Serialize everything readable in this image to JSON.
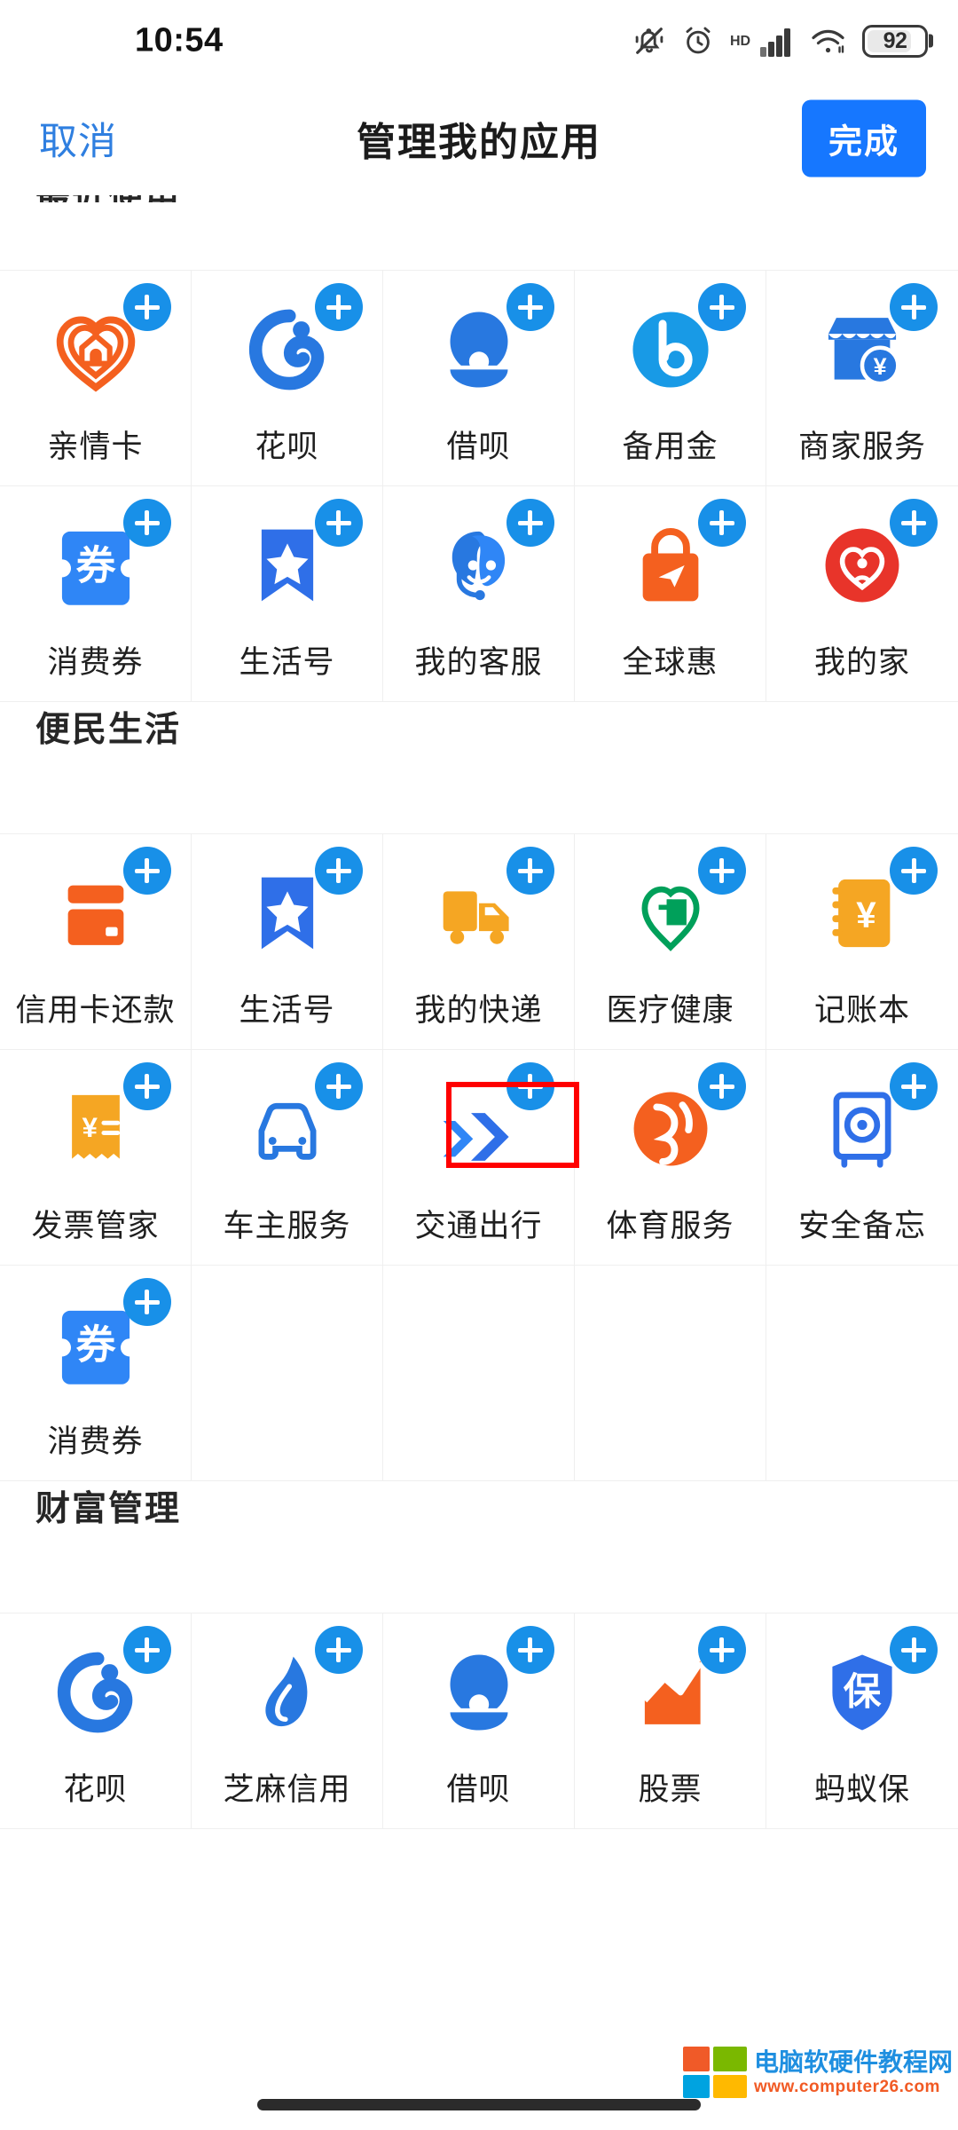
{
  "status_bar": {
    "time": "10:54",
    "battery_level": "92",
    "icons": [
      "bell-mute-icon",
      "alarm-clock-icon",
      "hd-icon",
      "signal-bars-icon",
      "wifi-icon",
      "battery-icon"
    ]
  },
  "nav": {
    "cancel_label": "取消",
    "title": "管理我的应用",
    "done_label": "完成"
  },
  "colors": {
    "accent_blue": "#1677ff",
    "plus_blue": "#1890e8",
    "link_blue": "#2f7fe0",
    "highlight_red": "#ff0000",
    "orange": "#f4601f",
    "green": "#00a05a",
    "yellow": "#f5a623",
    "red": "#e8342a"
  },
  "sections": [
    {
      "title": "最近使用",
      "clipped": true,
      "apps": [
        {
          "label": "亲情卡",
          "icon": "family-card-icon",
          "action": "add"
        },
        {
          "label": "花呗",
          "icon": "huabei-icon",
          "action": "add"
        },
        {
          "label": "借呗",
          "icon": "jiebei-icon",
          "action": "add"
        },
        {
          "label": "备用金",
          "icon": "reserve-fund-icon",
          "action": "add"
        },
        {
          "label": "商家服务",
          "icon": "merchant-service-icon",
          "action": "add"
        },
        {
          "label": "消费券",
          "icon": "coupon-icon",
          "action": "add"
        },
        {
          "label": "生活号",
          "icon": "life-account-icon",
          "action": "add"
        },
        {
          "label": "我的客服",
          "icon": "customer-service-icon",
          "action": "add"
        },
        {
          "label": "全球惠",
          "icon": "global-deals-icon",
          "action": "add"
        },
        {
          "label": "我的家",
          "icon": "my-home-icon",
          "action": "add"
        }
      ]
    },
    {
      "title": "便民生活",
      "clipped": false,
      "apps": [
        {
          "label": "信用卡还款",
          "icon": "credit-card-repay-icon",
          "action": "add"
        },
        {
          "label": "生活号",
          "icon": "life-account-icon",
          "action": "add"
        },
        {
          "label": "我的快递",
          "icon": "delivery-truck-icon",
          "action": "add"
        },
        {
          "label": "医疗健康",
          "icon": "medical-health-icon",
          "action": "add"
        },
        {
          "label": "记账本",
          "icon": "ledger-book-icon",
          "action": "add"
        },
        {
          "label": "发票管家",
          "icon": "invoice-manager-icon",
          "action": "add"
        },
        {
          "label": "车主服务",
          "icon": "car-owner-service-icon",
          "action": "add"
        },
        {
          "label": "交通出行",
          "icon": "transport-travel-icon",
          "action": "add",
          "highlighted": true
        },
        {
          "label": "体育服务",
          "icon": "sports-service-icon",
          "action": "add"
        },
        {
          "label": "安全备忘",
          "icon": "security-memo-icon",
          "action": "add"
        },
        {
          "label": "消费券",
          "icon": "coupon-icon",
          "action": "add"
        }
      ]
    },
    {
      "title": "财富管理",
      "clipped": false,
      "apps": [
        {
          "label": "花呗",
          "icon": "huabei-icon",
          "action": "add"
        },
        {
          "label": "芝麻信用",
          "icon": "zhima-credit-icon",
          "action": "add"
        },
        {
          "label": "借呗",
          "icon": "jiebei-icon",
          "action": "add"
        },
        {
          "label": "股票",
          "icon": "stock-chart-icon",
          "action": "add"
        },
        {
          "label": "蚂蚁保",
          "icon": "ant-insurance-icon",
          "action": "add"
        }
      ]
    }
  ],
  "watermark": {
    "site_name": "电脑软硬件教程网",
    "url": "www.computer26.com"
  }
}
